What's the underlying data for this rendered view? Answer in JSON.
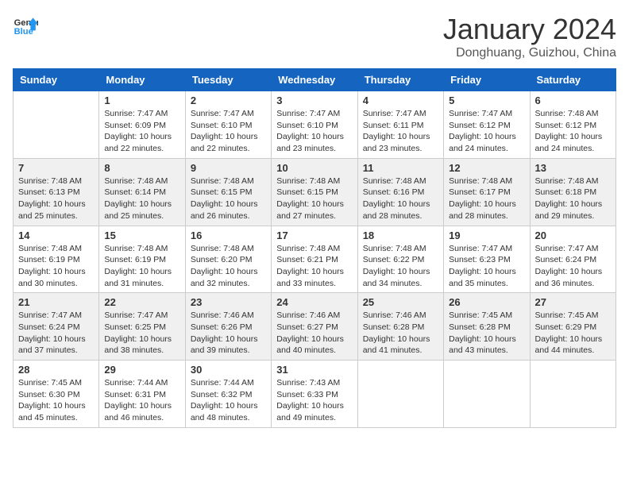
{
  "header": {
    "logo_text_general": "General",
    "logo_text_blue": "Blue",
    "month_year": "January 2024",
    "location": "Donghuang, Guizhou, China"
  },
  "calendar": {
    "days_of_week": [
      "Sunday",
      "Monday",
      "Tuesday",
      "Wednesday",
      "Thursday",
      "Friday",
      "Saturday"
    ],
    "weeks": [
      [
        {
          "day": "",
          "info": ""
        },
        {
          "day": "1",
          "info": "Sunrise: 7:47 AM\nSunset: 6:09 PM\nDaylight: 10 hours\nand 22 minutes."
        },
        {
          "day": "2",
          "info": "Sunrise: 7:47 AM\nSunset: 6:10 PM\nDaylight: 10 hours\nand 22 minutes."
        },
        {
          "day": "3",
          "info": "Sunrise: 7:47 AM\nSunset: 6:10 PM\nDaylight: 10 hours\nand 23 minutes."
        },
        {
          "day": "4",
          "info": "Sunrise: 7:47 AM\nSunset: 6:11 PM\nDaylight: 10 hours\nand 23 minutes."
        },
        {
          "day": "5",
          "info": "Sunrise: 7:47 AM\nSunset: 6:12 PM\nDaylight: 10 hours\nand 24 minutes."
        },
        {
          "day": "6",
          "info": "Sunrise: 7:48 AM\nSunset: 6:12 PM\nDaylight: 10 hours\nand 24 minutes."
        }
      ],
      [
        {
          "day": "7",
          "info": "Sunrise: 7:48 AM\nSunset: 6:13 PM\nDaylight: 10 hours\nand 25 minutes."
        },
        {
          "day": "8",
          "info": "Sunrise: 7:48 AM\nSunset: 6:14 PM\nDaylight: 10 hours\nand 25 minutes."
        },
        {
          "day": "9",
          "info": "Sunrise: 7:48 AM\nSunset: 6:15 PM\nDaylight: 10 hours\nand 26 minutes."
        },
        {
          "day": "10",
          "info": "Sunrise: 7:48 AM\nSunset: 6:15 PM\nDaylight: 10 hours\nand 27 minutes."
        },
        {
          "day": "11",
          "info": "Sunrise: 7:48 AM\nSunset: 6:16 PM\nDaylight: 10 hours\nand 28 minutes."
        },
        {
          "day": "12",
          "info": "Sunrise: 7:48 AM\nSunset: 6:17 PM\nDaylight: 10 hours\nand 28 minutes."
        },
        {
          "day": "13",
          "info": "Sunrise: 7:48 AM\nSunset: 6:18 PM\nDaylight: 10 hours\nand 29 minutes."
        }
      ],
      [
        {
          "day": "14",
          "info": "Sunrise: 7:48 AM\nSunset: 6:19 PM\nDaylight: 10 hours\nand 30 minutes."
        },
        {
          "day": "15",
          "info": "Sunrise: 7:48 AM\nSunset: 6:19 PM\nDaylight: 10 hours\nand 31 minutes."
        },
        {
          "day": "16",
          "info": "Sunrise: 7:48 AM\nSunset: 6:20 PM\nDaylight: 10 hours\nand 32 minutes."
        },
        {
          "day": "17",
          "info": "Sunrise: 7:48 AM\nSunset: 6:21 PM\nDaylight: 10 hours\nand 33 minutes."
        },
        {
          "day": "18",
          "info": "Sunrise: 7:48 AM\nSunset: 6:22 PM\nDaylight: 10 hours\nand 34 minutes."
        },
        {
          "day": "19",
          "info": "Sunrise: 7:47 AM\nSunset: 6:23 PM\nDaylight: 10 hours\nand 35 minutes."
        },
        {
          "day": "20",
          "info": "Sunrise: 7:47 AM\nSunset: 6:24 PM\nDaylight: 10 hours\nand 36 minutes."
        }
      ],
      [
        {
          "day": "21",
          "info": "Sunrise: 7:47 AM\nSunset: 6:24 PM\nDaylight: 10 hours\nand 37 minutes."
        },
        {
          "day": "22",
          "info": "Sunrise: 7:47 AM\nSunset: 6:25 PM\nDaylight: 10 hours\nand 38 minutes."
        },
        {
          "day": "23",
          "info": "Sunrise: 7:46 AM\nSunset: 6:26 PM\nDaylight: 10 hours\nand 39 minutes."
        },
        {
          "day": "24",
          "info": "Sunrise: 7:46 AM\nSunset: 6:27 PM\nDaylight: 10 hours\nand 40 minutes."
        },
        {
          "day": "25",
          "info": "Sunrise: 7:46 AM\nSunset: 6:28 PM\nDaylight: 10 hours\nand 41 minutes."
        },
        {
          "day": "26",
          "info": "Sunrise: 7:45 AM\nSunset: 6:28 PM\nDaylight: 10 hours\nand 43 minutes."
        },
        {
          "day": "27",
          "info": "Sunrise: 7:45 AM\nSunset: 6:29 PM\nDaylight: 10 hours\nand 44 minutes."
        }
      ],
      [
        {
          "day": "28",
          "info": "Sunrise: 7:45 AM\nSunset: 6:30 PM\nDaylight: 10 hours\nand 45 minutes."
        },
        {
          "day": "29",
          "info": "Sunrise: 7:44 AM\nSunset: 6:31 PM\nDaylight: 10 hours\nand 46 minutes."
        },
        {
          "day": "30",
          "info": "Sunrise: 7:44 AM\nSunset: 6:32 PM\nDaylight: 10 hours\nand 48 minutes."
        },
        {
          "day": "31",
          "info": "Sunrise: 7:43 AM\nSunset: 6:33 PM\nDaylight: 10 hours\nand 49 minutes."
        },
        {
          "day": "",
          "info": ""
        },
        {
          "day": "",
          "info": ""
        },
        {
          "day": "",
          "info": ""
        }
      ]
    ]
  }
}
